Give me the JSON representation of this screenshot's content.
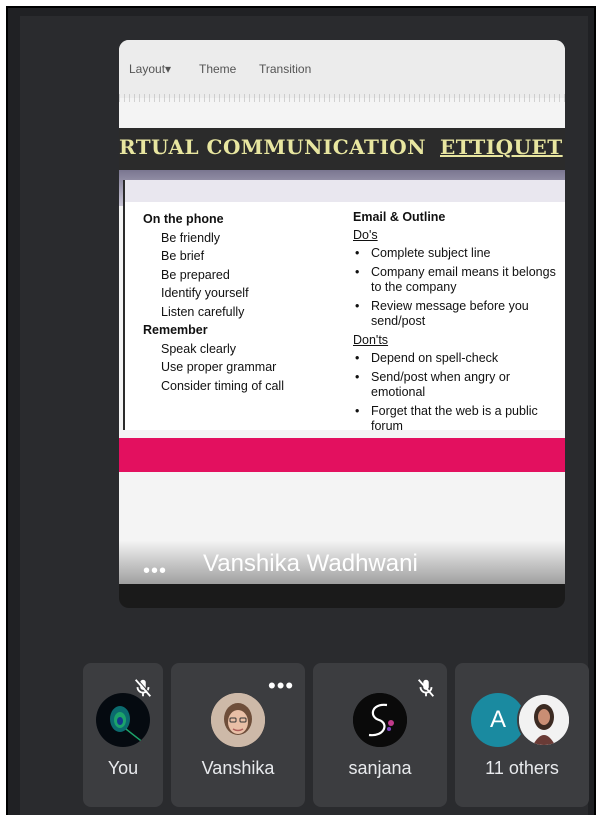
{
  "slide_toolbar": {
    "layout": "Layout▾",
    "theme": "Theme",
    "transition": "Transition"
  },
  "slide": {
    "title_main": "RTUAL COMMUNICATION",
    "title_tail": "ETTIQUET",
    "left": {
      "heading1": "On the phone",
      "items1": [
        "Be friendly",
        "Be brief",
        "Be prepared",
        "Identify yourself",
        "Listen carefully"
      ],
      "heading2": "Remember",
      "items2": [
        "Speak clearly",
        "Use proper grammar",
        "Consider timing of call"
      ]
    },
    "right": {
      "heading": "Email & Outline",
      "dos_label": "Do's",
      "dos": [
        "Complete subject line",
        "Company email means it belongs to the company",
        "Review message before you send/post"
      ],
      "donts_label": "Don'ts",
      "donts": [
        "Depend on spell-check",
        "Send/post when angry or emotional",
        "Forget that the web is a public forum"
      ]
    }
  },
  "presenter": {
    "more": "•••",
    "name": "Vanshika Wadhwani"
  },
  "participants": {
    "you": {
      "name": "You"
    },
    "vanshika": {
      "name": "Vanshika",
      "more": "•••"
    },
    "sanjana": {
      "name": "sanjana"
    },
    "others": {
      "name": "11 others",
      "initial": "A"
    }
  },
  "colors": {
    "accent_pink": "#e3105f",
    "avatar_teal": "#1a8aa0",
    "tile": "#3c3d40"
  }
}
